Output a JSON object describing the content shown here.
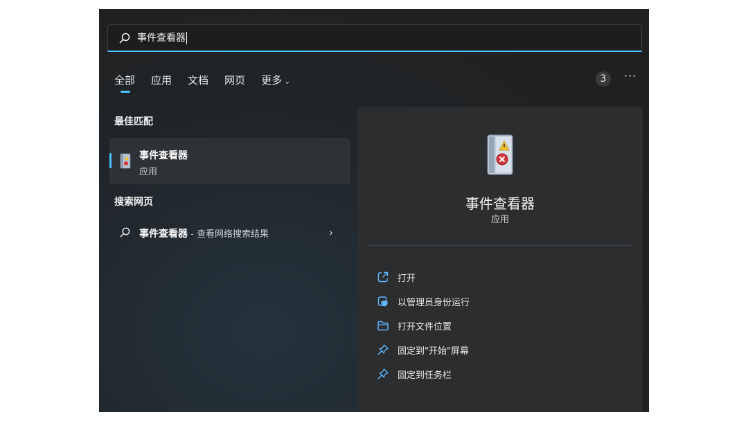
{
  "search": {
    "query": "事件查看器"
  },
  "tabs": [
    {
      "label": "全部",
      "active": true
    },
    {
      "label": "应用"
    },
    {
      "label": "文档"
    },
    {
      "label": "网页"
    },
    {
      "label": "更多"
    }
  ],
  "header": {
    "count_badge": "3"
  },
  "best_match": {
    "section_title": "最佳匹配",
    "item": {
      "name": "事件查看器",
      "kind": "应用",
      "icon": "event-viewer-icon"
    }
  },
  "web_search": {
    "section_title": "搜索网页",
    "item": {
      "query": "事件查看器",
      "suffix": " - 查看网络搜索结果"
    }
  },
  "detail": {
    "title": "事件查看器",
    "kind": "应用",
    "actions": [
      {
        "label": "打开",
        "icon": "open-external-icon"
      },
      {
        "label": "以管理员身份运行",
        "icon": "shield-admin-icon"
      },
      {
        "label": "打开文件位置",
        "icon": "folder-icon"
      },
      {
        "label": "固定到\"开始\"屏幕",
        "icon": "pin-icon"
      },
      {
        "label": "固定到任务栏",
        "icon": "pin-icon"
      }
    ]
  },
  "colors": {
    "accent": "#4cc2ff",
    "background": "#202020",
    "panel": "#2b2d2f"
  }
}
